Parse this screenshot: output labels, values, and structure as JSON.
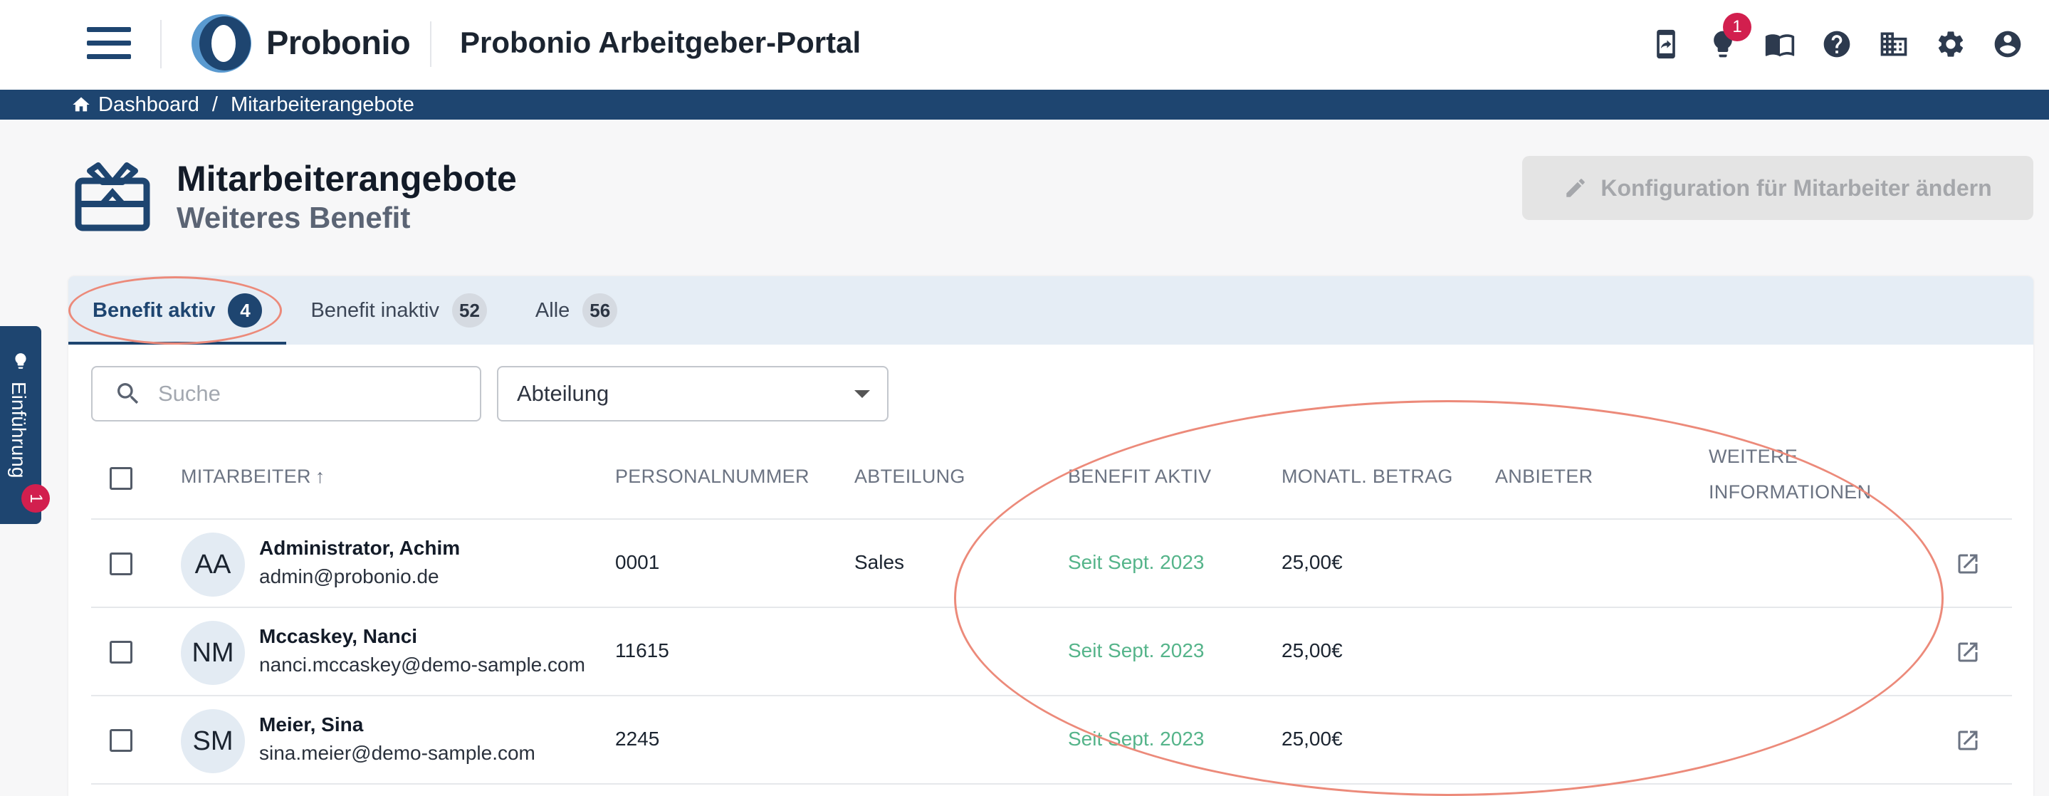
{
  "header": {
    "brand": "Probonio",
    "portal_title": "Probonio Arbeitgeber-Portal",
    "notification_count": "1",
    "icons": [
      "mobile-share-icon",
      "lightbulb-icon",
      "book-icon",
      "help-icon",
      "building-icon",
      "settings-icon",
      "account-icon"
    ]
  },
  "breadcrumb": {
    "home": "Dashboard",
    "separator": "/",
    "current": "Mitarbeiterangebote"
  },
  "page": {
    "title": "Mitarbeiterangebote",
    "subtitle": "Weiteres Benefit",
    "config_button": "Konfiguration für Mitarbeiter ändern"
  },
  "tabs": [
    {
      "label": "Benefit aktiv",
      "count": "4",
      "active": true
    },
    {
      "label": "Benefit inaktiv",
      "count": "52",
      "active": false
    },
    {
      "label": "Alle",
      "count": "56",
      "active": false
    }
  ],
  "filters": {
    "search_placeholder": "Suche",
    "department_select": "Abteilung"
  },
  "table": {
    "columns": {
      "employee": "MITARBEITER",
      "sort_indicator": "↑",
      "personnel_number": "PERSONALNUMMER",
      "department": "ABTEILUNG",
      "benefit_active": "BENEFIT AKTIV",
      "monthly_amount": "MONATL. BETRAG",
      "provider": "ANBIETER",
      "more_info_line1": "WEITERE",
      "more_info_line2": "INFORMATIONEN"
    },
    "rows": [
      {
        "initials": "AA",
        "name": "Administrator, Achim",
        "email": "admin@probonio.de",
        "personnel_number": "0001",
        "department": "Sales",
        "benefit_active": "Seit Sept. 2023",
        "monthly_amount": "25,00€",
        "provider": ""
      },
      {
        "initials": "NM",
        "name": "Mccaskey, Nanci",
        "email": "nanci.mccaskey@demo-sample.com",
        "personnel_number": "11615",
        "department": "",
        "benefit_active": "Seit Sept. 2023",
        "monthly_amount": "25,00€",
        "provider": ""
      },
      {
        "initials": "SM",
        "name": "Meier, Sina",
        "email": "sina.meier@demo-sample.com",
        "personnel_number": "2245",
        "department": "",
        "benefit_active": "Seit Sept. 2023",
        "monthly_amount": "25,00€",
        "provider": ""
      }
    ]
  },
  "side_tab": {
    "label": "Einführung",
    "badge": "1"
  },
  "colors": {
    "primary": "#1e4570",
    "accent_red": "#d21f4e",
    "success_green": "#55b48a",
    "annotation": "#ec8a7a"
  }
}
